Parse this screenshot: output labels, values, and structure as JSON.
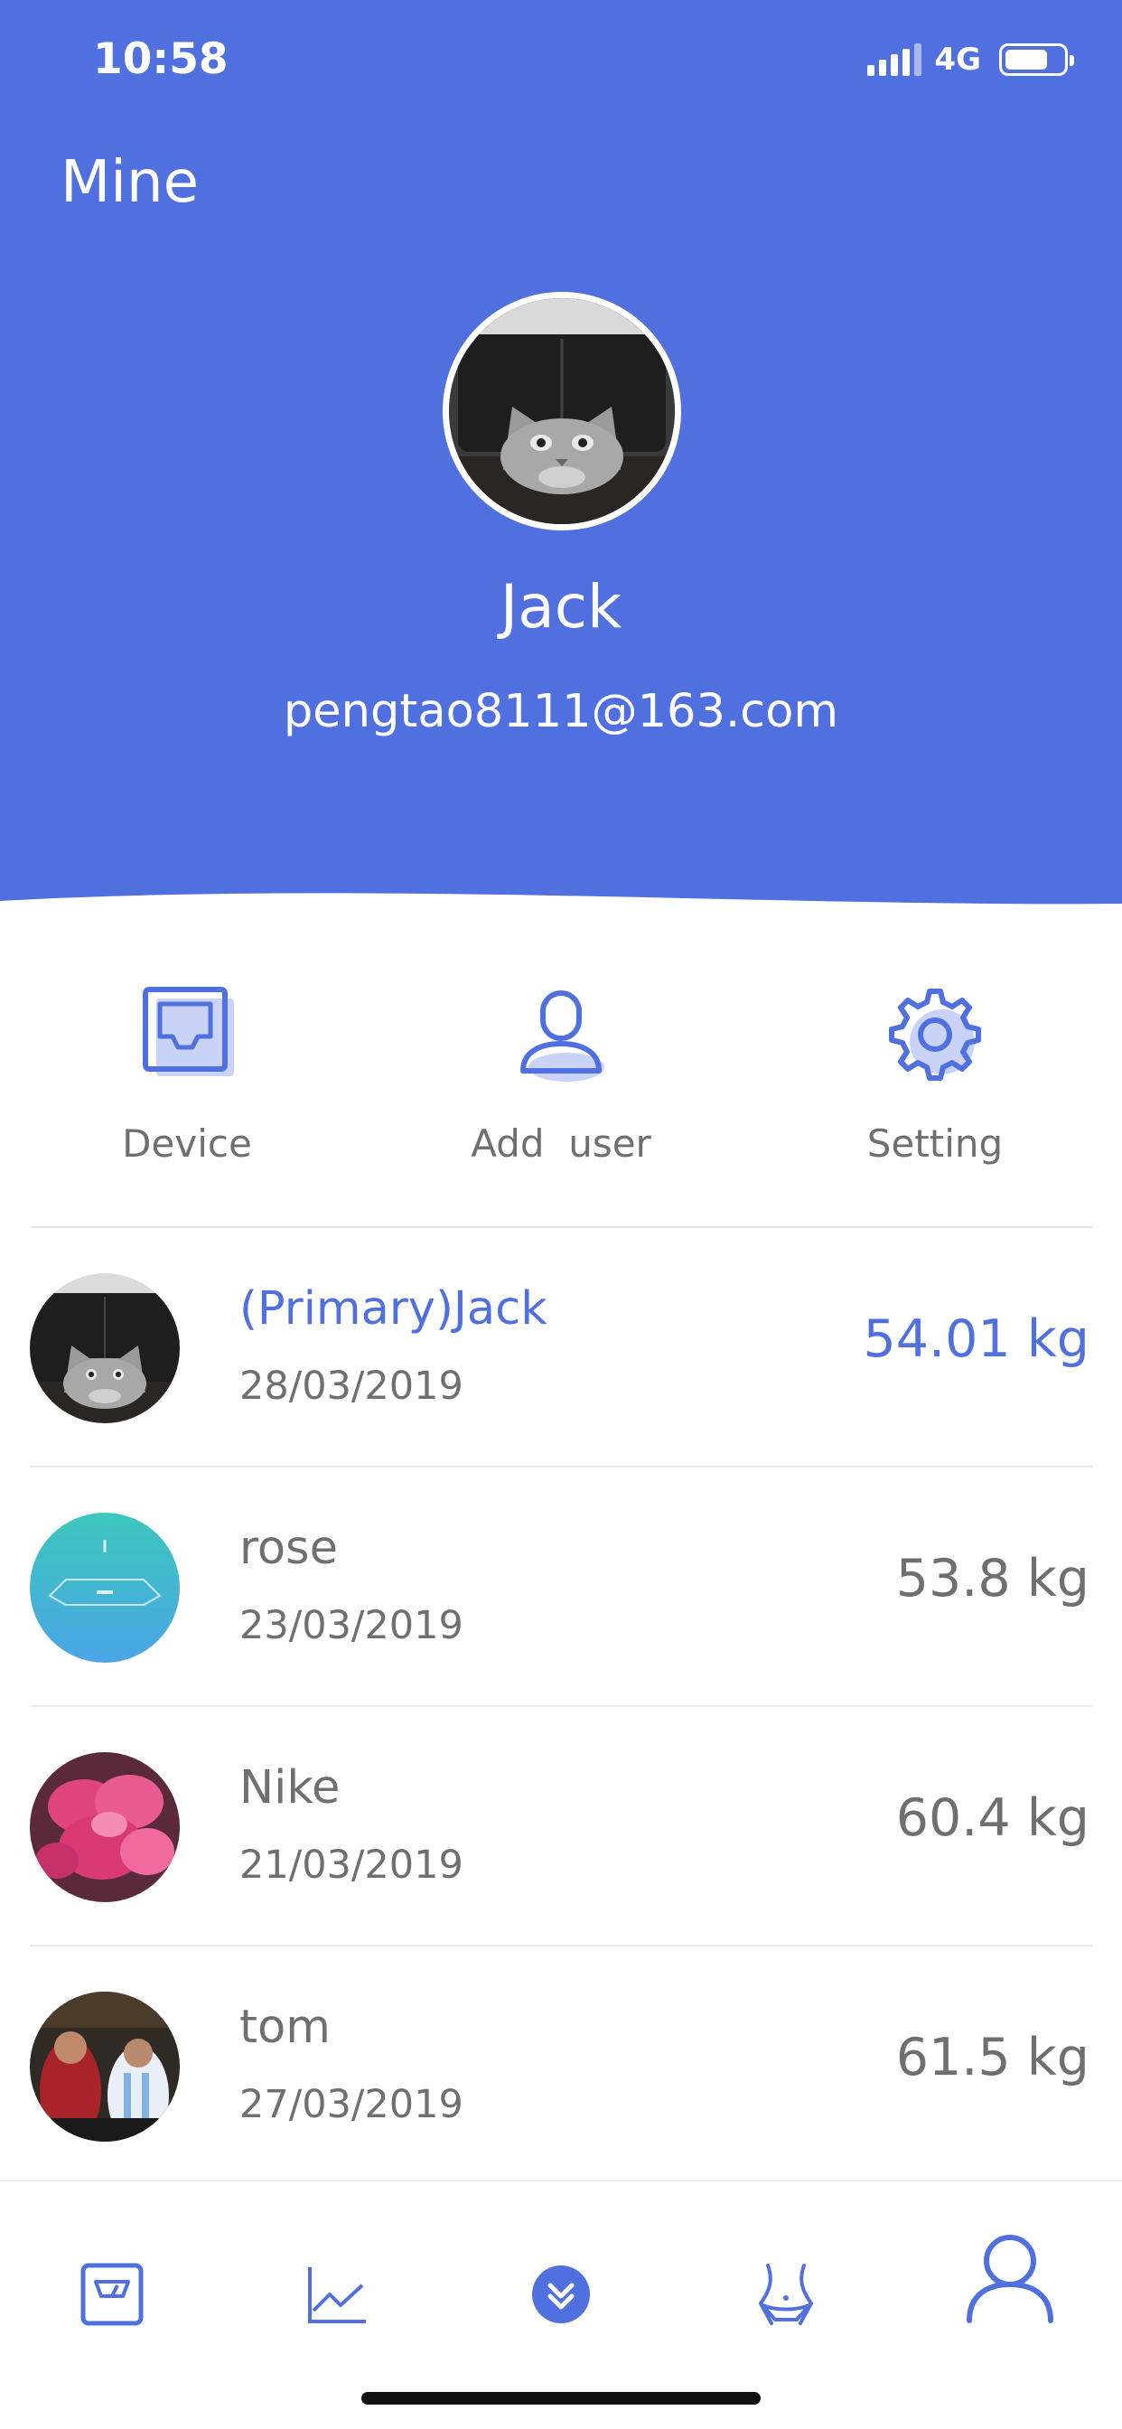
{
  "status_bar": {
    "time": "10:58",
    "network": "4G"
  },
  "header": {
    "title": "Mine"
  },
  "profile": {
    "name": "Jack",
    "email": "pengtao8111@163.com"
  },
  "quick_actions": [
    {
      "label": "Device",
      "icon": "device-icon"
    },
    {
      "label": "Add  user",
      "icon": "add-user-icon"
    },
    {
      "label": "Setting",
      "icon": "gear-icon"
    }
  ],
  "users": [
    {
      "name": "(Primary)Jack",
      "date": "28/03/2019",
      "weight": "54.01 kg",
      "primary": true
    },
    {
      "name": "rose",
      "date": "23/03/2019",
      "weight": "53.8 kg",
      "primary": false
    },
    {
      "name": "Nike",
      "date": "21/03/2019",
      "weight": "60.4 kg",
      "primary": false
    },
    {
      "name": "tom",
      "date": "27/03/2019",
      "weight": "61.5 kg",
      "primary": false
    }
  ],
  "tabbar": [
    {
      "icon": "scale-icon"
    },
    {
      "icon": "chart-icon"
    },
    {
      "icon": "double-chevron-icon"
    },
    {
      "icon": "body-icon"
    },
    {
      "icon": "profile-icon",
      "active": true
    }
  ],
  "colors": {
    "accent": "#5070df",
    "text_gray": "#6f6f6f"
  }
}
